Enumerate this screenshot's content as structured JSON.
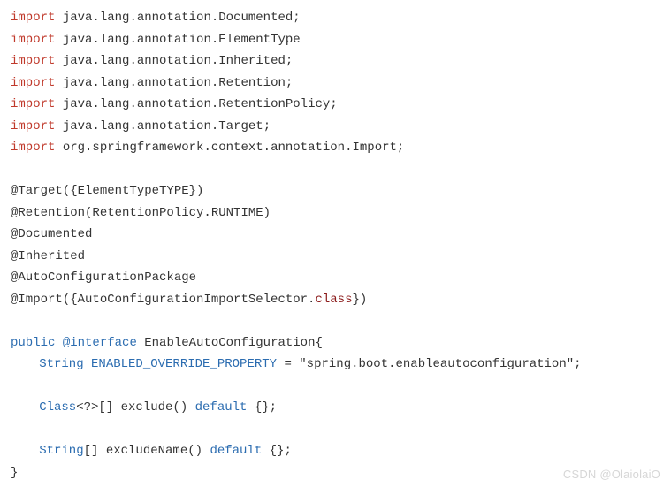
{
  "code": {
    "import_kw": "import",
    "pkg_java_lang_annotation": "java.lang.annotation",
    "pkg_spring": "org.springframework.context.annotation",
    "imp1": "Documented",
    "imp2": "ElementType",
    "imp3": "Inherited",
    "imp4": "Retention",
    "imp5": "RetentionPolicy",
    "imp6": "Target",
    "imp7": "Import",
    "ann_target": "@Target({ElementTypeTYPE})",
    "ann_retention": "@Retention(RetentionPolicy.RUNTIME)",
    "ann_documented": "@Documented",
    "ann_inherited": "@Inherited",
    "ann_autopkg": "@AutoConfigurationPackage",
    "ann_import_pre": "@Import({AutoConfigurationImportSelector.",
    "class_kw": "class",
    "ann_import_post": "})",
    "public_kw": "public",
    "interface_kw": "@interface",
    "iface_name": "EnableAutoConfiguration",
    "string_type": "String",
    "const_name": "ENABLED_OVERRIDE_PROPERTY",
    "const_eq": " = ",
    "const_val": "\"spring.boot.enableautoconfiguration\";",
    "class_type": "Class",
    "exclude_sig": "<?>[] exclude() ",
    "default_kw": "default",
    "default_body": " {};",
    "string_arr": "[] excludeName() ",
    "brace_open": "{",
    "brace_close": "}"
  },
  "watermark": "CSDN @OlaiolaiO"
}
